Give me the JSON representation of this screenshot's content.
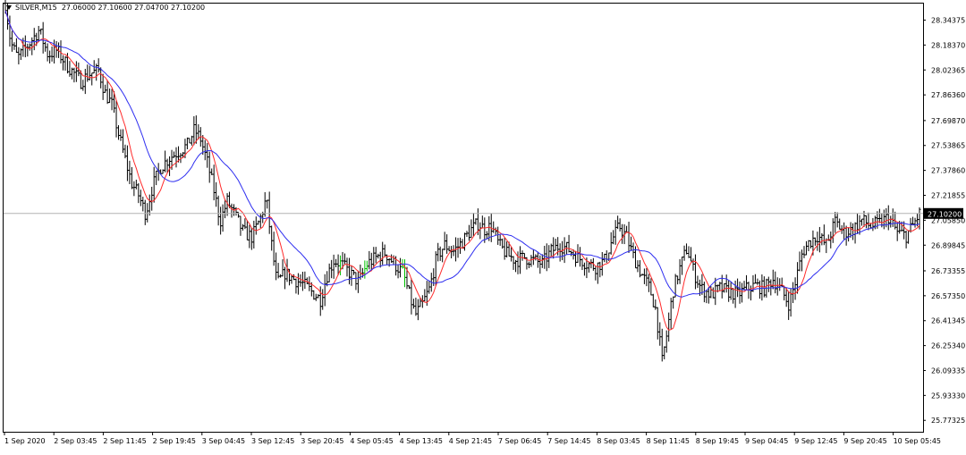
{
  "header": {
    "symbol": "SILVER,M15",
    "ohlc": "27.06000 27.10600 27.04700 27.10200"
  },
  "chart_data": {
    "type": "bar",
    "symbol": "SILVER,M15",
    "timeframe": "M15",
    "ohlc_label": "27.06000 27.10600 27.04700 27.10200",
    "current_price": 27.102,
    "current_price_label": "27.10200",
    "ylim": [
      25.7,
      28.45
    ],
    "yticks": [
      28.34375,
      28.1837,
      28.02365,
      27.8636,
      27.6987,
      27.53865,
      27.3786,
      27.21855,
      27.0585,
      26.89845,
      26.73355,
      26.5735,
      26.41345,
      26.2534,
      26.09335,
      25.9333,
      25.77325
    ],
    "ytick_labels": [
      "28.34375",
      "28.18370",
      "28.02365",
      "27.86360",
      "27.69870",
      "27.53865",
      "27.37860",
      "27.21855",
      "27.05850",
      "26.89845",
      "26.73355",
      "26.57350",
      "26.41345",
      "26.25340",
      "26.09335",
      "25.93330",
      "25.77325"
    ],
    "xtick_labels": [
      "1 Sep 2020",
      "2 Sep 03:45",
      "2 Sep 11:45",
      "2 Sep 19:45",
      "3 Sep 04:45",
      "3 Sep 12:45",
      "3 Sep 20:45",
      "4 Sep 05:45",
      "4 Sep 13:45",
      "4 Sep 21:45",
      "7 Sep 06:45",
      "7 Sep 14:45",
      "8 Sep 03:45",
      "8 Sep 11:45",
      "8 Sep 19:45",
      "9 Sep 04:45",
      "9 Sep 12:45",
      "9 Sep 20:45",
      "10 Sep 05:45"
    ],
    "price_path": [
      [
        0,
        28.45
      ],
      [
        6,
        28.2
      ],
      [
        14,
        28.1
      ],
      [
        25,
        28.18
      ],
      [
        38,
        28.28
      ],
      [
        48,
        28.12
      ],
      [
        58,
        28.15
      ],
      [
        70,
        28.05
      ],
      [
        85,
        27.95
      ],
      [
        95,
        28.0
      ],
      [
        105,
        28.02
      ],
      [
        112,
        27.88
      ],
      [
        120,
        27.8
      ],
      [
        128,
        27.6
      ],
      [
        135,
        27.45
      ],
      [
        142,
        27.3
      ],
      [
        150,
        27.22
      ],
      [
        158,
        27.1
      ],
      [
        166,
        27.28
      ],
      [
        175,
        27.4
      ],
      [
        185,
        27.46
      ],
      [
        195,
        27.5
      ],
      [
        205,
        27.54
      ],
      [
        213,
        27.64
      ],
      [
        220,
        27.58
      ],
      [
        228,
        27.42
      ],
      [
        235,
        27.25
      ],
      [
        242,
        27.05
      ],
      [
        250,
        27.18
      ],
      [
        258,
        27.1
      ],
      [
        268,
        26.98
      ],
      [
        278,
        26.95
      ],
      [
        288,
        27.08
      ],
      [
        294,
        27.2
      ],
      [
        300,
        26.9
      ],
      [
        306,
        26.65
      ],
      [
        315,
        26.72
      ],
      [
        325,
        26.68
      ],
      [
        335,
        26.65
      ],
      [
        345,
        26.6
      ],
      [
        355,
        26.55
      ],
      [
        362,
        26.7
      ],
      [
        370,
        26.8
      ],
      [
        378,
        26.78
      ],
      [
        388,
        26.72
      ],
      [
        398,
        26.66
      ],
      [
        408,
        26.78
      ],
      [
        418,
        26.82
      ],
      [
        428,
        26.85
      ],
      [
        438,
        26.78
      ],
      [
        448,
        26.72
      ],
      [
        455,
        26.58
      ],
      [
        462,
        26.45
      ],
      [
        470,
        26.52
      ],
      [
        478,
        26.62
      ],
      [
        486,
        26.82
      ],
      [
        495,
        26.9
      ],
      [
        505,
        26.86
      ],
      [
        515,
        26.92
      ],
      [
        525,
        27.0
      ],
      [
        533,
        27.04
      ],
      [
        540,
        27.0
      ],
      [
        548,
        27.02
      ],
      [
        556,
        26.9
      ],
      [
        565,
        26.84
      ],
      [
        575,
        26.8
      ],
      [
        585,
        26.82
      ],
      [
        595,
        26.8
      ],
      [
        605,
        26.78
      ],
      [
        615,
        26.86
      ],
      [
        625,
        26.9
      ],
      [
        635,
        26.87
      ],
      [
        645,
        26.82
      ],
      [
        655,
        26.78
      ],
      [
        665,
        26.76
      ],
      [
        675,
        26.8
      ],
      [
        685,
        26.95
      ],
      [
        692,
        27.02
      ],
      [
        700,
        26.95
      ],
      [
        708,
        26.82
      ],
      [
        718,
        26.7
      ],
      [
        726,
        26.62
      ],
      [
        733,
        26.48
      ],
      [
        740,
        26.15
      ],
      [
        746,
        26.35
      ],
      [
        752,
        26.6
      ],
      [
        760,
        26.75
      ],
      [
        768,
        26.88
      ],
      [
        776,
        26.72
      ],
      [
        784,
        26.62
      ],
      [
        795,
        26.58
      ],
      [
        805,
        26.62
      ],
      [
        815,
        26.6
      ],
      [
        825,
        26.58
      ],
      [
        835,
        26.62
      ],
      [
        845,
        26.64
      ],
      [
        855,
        26.62
      ],
      [
        865,
        26.68
      ],
      [
        875,
        26.6
      ],
      [
        883,
        26.52
      ],
      [
        890,
        26.66
      ],
      [
        898,
        26.85
      ],
      [
        906,
        26.92
      ],
      [
        915,
        26.96
      ],
      [
        925,
        26.9
      ],
      [
        935,
        27.05
      ],
      [
        945,
        26.98
      ],
      [
        955,
        27.0
      ],
      [
        965,
        27.06
      ],
      [
        975,
        27.02
      ],
      [
        985,
        27.04
      ],
      [
        995,
        27.08
      ],
      [
        1005,
        26.98
      ],
      [
        1015,
        26.96
      ],
      [
        1022,
        27.02
      ],
      [
        1030,
        27.1
      ]
    ],
    "series": [
      {
        "name": "",
        "color": "#ff2a2a"
      },
      {
        "name": "",
        "color": "#2e2ef0"
      }
    ],
    "colors": {
      "bars": "#000000",
      "up_bars": "#00c000",
      "fast_ma": "#ff2a2a",
      "slow_ma": "#2e2ef0",
      "price_line": "#b4b4b4",
      "price_tag_bg": "#000000",
      "price_tag_fg": "#ffffff"
    },
    "grid": false
  }
}
